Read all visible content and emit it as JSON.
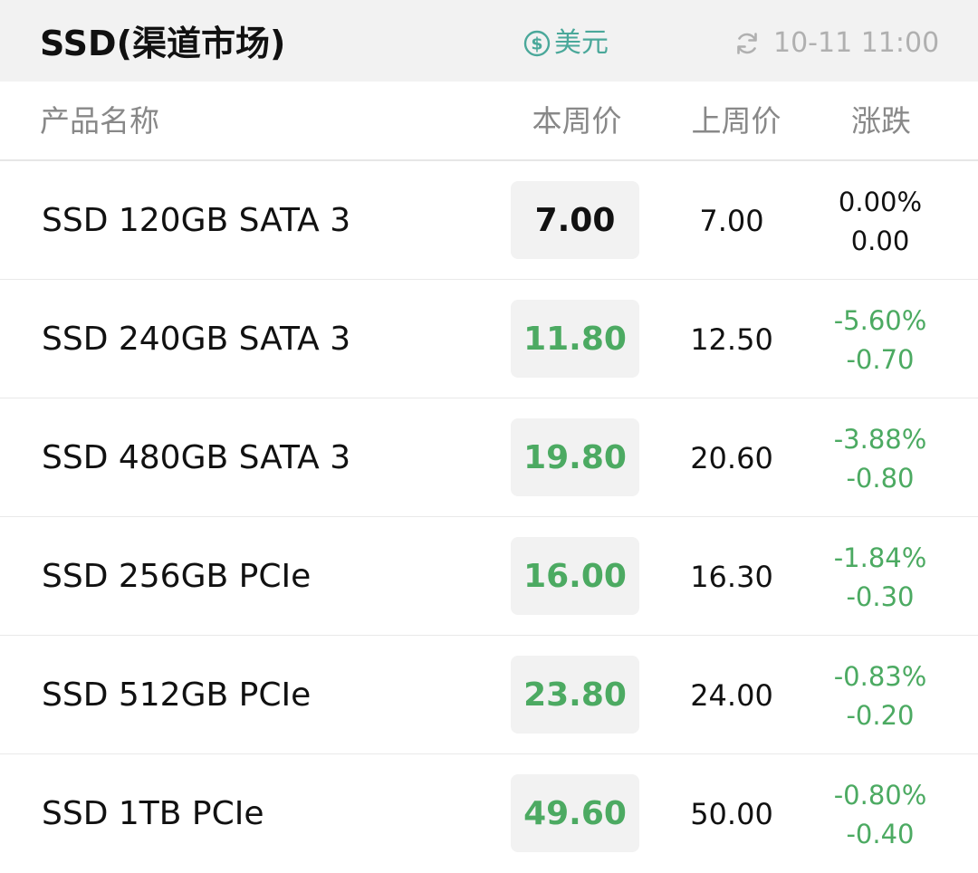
{
  "header": {
    "title": "SSD(渠道市场)",
    "currency_label": "美元",
    "currency_icon": "dollar-circle-icon",
    "refresh_icon": "refresh-icon",
    "updated_time": "10-11 11:00"
  },
  "columns": {
    "name": "产品名称",
    "this_week": "本周价",
    "last_week": "上周价",
    "change": "涨跌"
  },
  "colors": {
    "accent_teal": "#4aa89a",
    "down_green": "#4caa62",
    "neutral_text": "#111111"
  },
  "rows": [
    {
      "name": "SSD 120GB SATA 3",
      "this_week": "7.00",
      "last_week": "7.00",
      "change_pct": "0.00%",
      "change_abs": "0.00",
      "trend": "flat"
    },
    {
      "name": "SSD 240GB SATA 3",
      "this_week": "11.80",
      "last_week": "12.50",
      "change_pct": "-5.60%",
      "change_abs": "-0.70",
      "trend": "down"
    },
    {
      "name": "SSD 480GB SATA 3",
      "this_week": "19.80",
      "last_week": "20.60",
      "change_pct": "-3.88%",
      "change_abs": "-0.80",
      "trend": "down"
    },
    {
      "name": "SSD 256GB PCIe",
      "this_week": "16.00",
      "last_week": "16.30",
      "change_pct": "-1.84%",
      "change_abs": "-0.30",
      "trend": "down"
    },
    {
      "name": "SSD 512GB PCIe",
      "this_week": "23.80",
      "last_week": "24.00",
      "change_pct": "-0.83%",
      "change_abs": "-0.20",
      "trend": "down"
    },
    {
      "name": "SSD 1TB PCIe",
      "this_week": "49.60",
      "last_week": "50.00",
      "change_pct": "-0.80%",
      "change_abs": "-0.40",
      "trend": "down"
    }
  ]
}
